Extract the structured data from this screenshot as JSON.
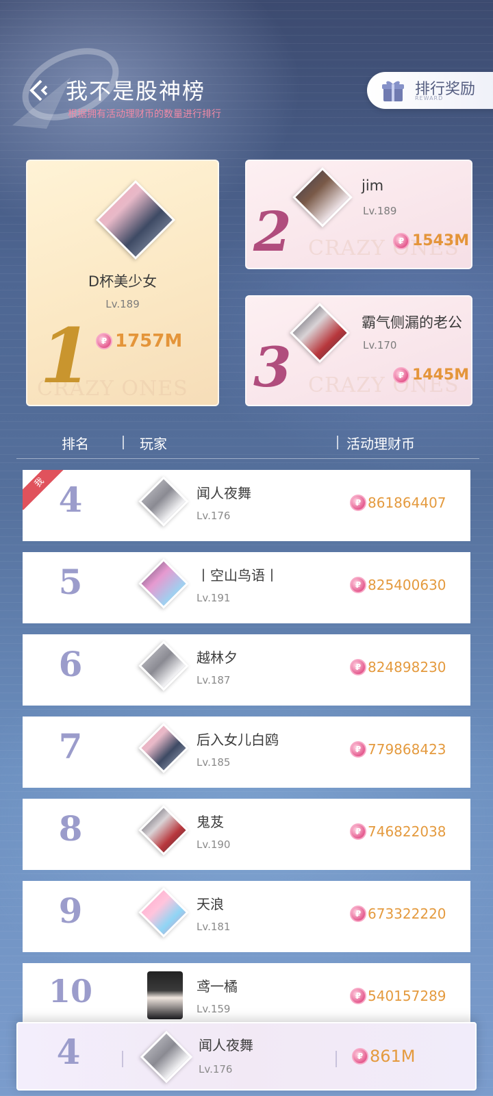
{
  "header": {
    "title": "我不是股神榜",
    "subtitle": "根据拥有活动理财币的数量进行排行",
    "reward_button": {
      "label": "排行奖励",
      "sub": "REWARD"
    }
  },
  "podium": [
    {
      "rank": "1",
      "name": "D杯美少女",
      "level": "Lv.189",
      "coins": "1757M",
      "watermark": "CRAZY ONES"
    },
    {
      "rank": "2",
      "name": "jim",
      "level": "Lv.189",
      "coins": "1543M",
      "watermark": "CRAZY ONES"
    },
    {
      "rank": "3",
      "name": "霸气侧漏的老公",
      "level": "Lv.170",
      "coins": "1445M",
      "watermark": "CRAZY ONES"
    }
  ],
  "list_header": {
    "rank": "排名",
    "player": "玩家",
    "currency": "活动理财币"
  },
  "rows": [
    {
      "rank": "4",
      "name": "闻人夜舞",
      "level": "Lv.176",
      "coins": "861864407",
      "badge": "我"
    },
    {
      "rank": "5",
      "name": "丨空山鸟语丨",
      "level": "Lv.191",
      "coins": "825400630"
    },
    {
      "rank": "6",
      "name": "越林夕",
      "level": "Lv.187",
      "coins": "824898230"
    },
    {
      "rank": "7",
      "name": "后入女儿白鸥",
      "level": "Lv.185",
      "coins": "779868423"
    },
    {
      "rank": "8",
      "name": "鬼芨",
      "level": "Lv.190",
      "coins": "746822038"
    },
    {
      "rank": "9",
      "name": "天浪",
      "level": "Lv.181",
      "coins": "673322220"
    },
    {
      "rank": "10",
      "name": "鸢一橘",
      "level": "Lv.159",
      "coins": "540157289"
    }
  ],
  "my_rank": {
    "rank": "4",
    "name": "闻人夜舞",
    "level": "Lv.176",
    "coins": "861M"
  },
  "colors": {
    "gold": "#c9952e",
    "rose": "#b04d7d",
    "coin_text": "#e49a3e",
    "rank_text": "#9b9ccb",
    "subtitle": "#f08aa7"
  }
}
